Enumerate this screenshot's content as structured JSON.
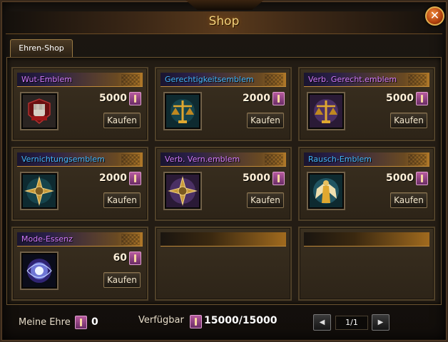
{
  "window": {
    "title": "Shop",
    "close_glyph": "✕"
  },
  "tabs": [
    {
      "label": "Ehren-Shop",
      "active": true
    }
  ],
  "items": [
    {
      "name": "Wut-Emblem",
      "name_color": "purple",
      "price": "5000",
      "button": "Kaufen",
      "icon": "fist-emblem-icon"
    },
    {
      "name": "Gerechtigkeitsemblem",
      "name_color": "blue",
      "price": "2000",
      "button": "Kaufen",
      "icon": "scales-emblem-icon"
    },
    {
      "name": "Verb. Gerecht.emblem",
      "name_color": "purple",
      "price": "5000",
      "button": "Kaufen",
      "icon": "scales-emblem-purple-icon"
    },
    {
      "name": "Vernichtungsemblem",
      "name_color": "blue",
      "price": "2000",
      "button": "Kaufen",
      "icon": "annihilation-emblem-icon"
    },
    {
      "name": "Verb. Vern.emblem",
      "name_color": "purple",
      "price": "5000",
      "button": "Kaufen",
      "icon": "annihilation-emblem-purple-icon"
    },
    {
      "name": "Rausch-Emblem",
      "name_color": "blue",
      "price": "5000",
      "button": "Kaufen",
      "icon": "angel-emblem-icon"
    },
    {
      "name": "Mode-Essenz",
      "name_color": "purple",
      "price": "60",
      "button": "Kaufen",
      "icon": "essence-orb-icon"
    }
  ],
  "footer": {
    "my_honor_label": "Meine Ehre",
    "my_honor_value": "0",
    "available_label": "Verfügbar",
    "available_value": "15000/15000",
    "page": "1/1",
    "prev_glyph": "◀",
    "next_glyph": "▶"
  },
  "colors": {
    "purple_name": "#d47bff",
    "blue_name": "#45b8ff",
    "title": "#f0cf7a",
    "close_button": "#b2420e"
  }
}
